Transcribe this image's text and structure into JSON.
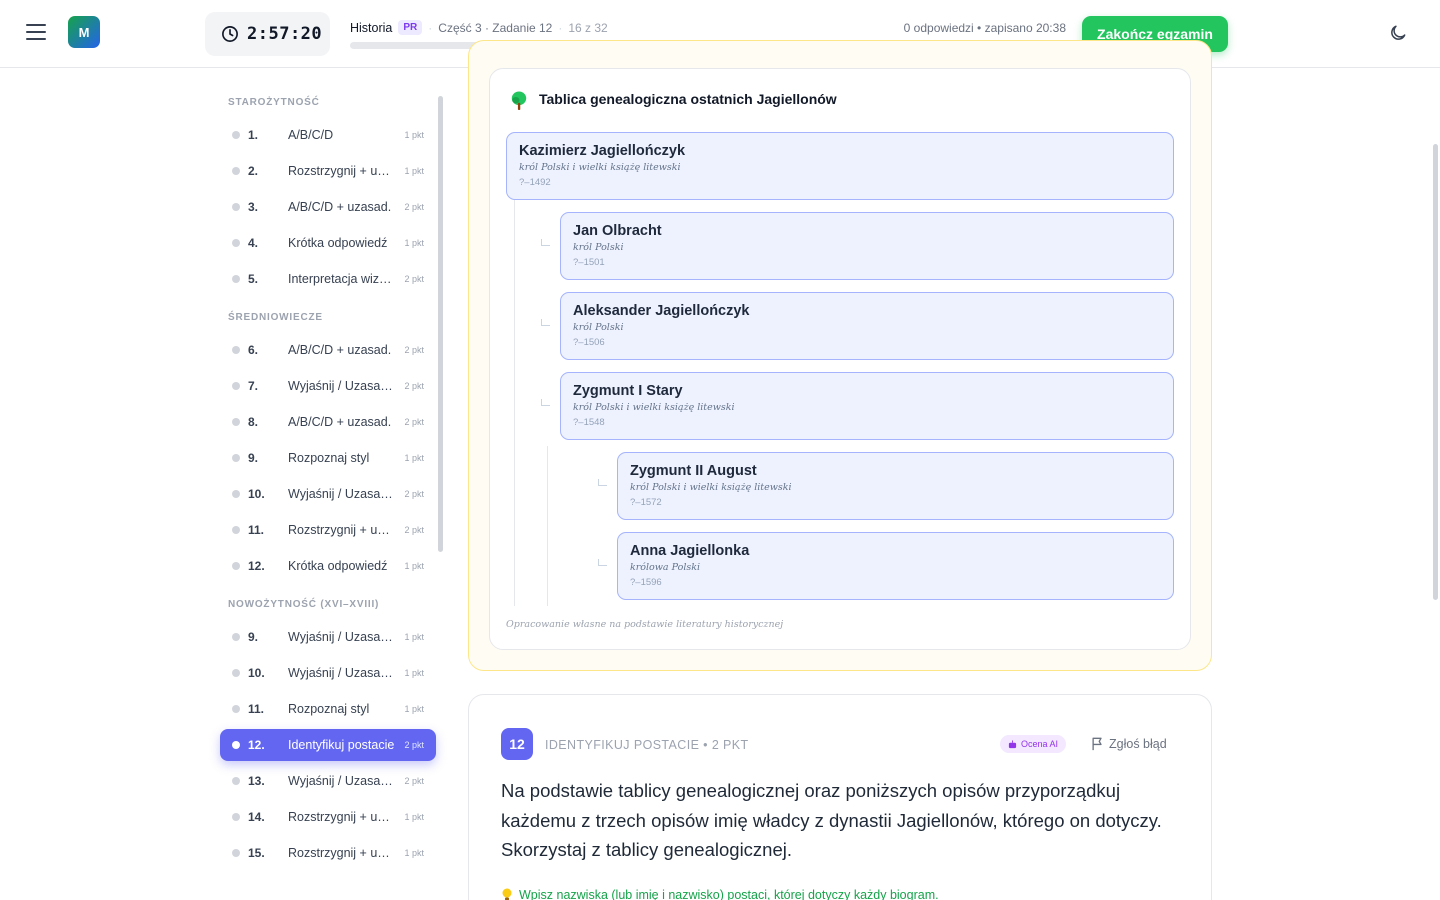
{
  "header": {
    "logo_letter": "M",
    "timer": "2:57:20",
    "subject": "Historia",
    "level_badge": "PR",
    "part_task": "Część 3 · Zadanie 12",
    "position": "16 z 32",
    "saved_status": "0 odpowiedzi • zapisano 20:38",
    "progress_fraction": 0.0,
    "finish_label": "Zakończ egzamin"
  },
  "sidebar": {
    "sections": [
      {
        "title": "STAROŻYTNOŚĆ",
        "items": [
          {
            "num": "1.",
            "label": "A/B/C/D",
            "pts": "1 pkt"
          },
          {
            "num": "2.",
            "label": "Rozstrzygnij + uzasad.",
            "pts": "1 pkt"
          },
          {
            "num": "3.",
            "label": "A/B/C/D + uzasad.",
            "pts": "2 pkt"
          },
          {
            "num": "4.",
            "label": "Krótka odpowiedź",
            "pts": "1 pkt"
          },
          {
            "num": "5.",
            "label": "Interpretacja wizualna",
            "pts": "2 pkt"
          }
        ]
      },
      {
        "title": "ŚREDNIOWIECZE",
        "items": [
          {
            "num": "6.",
            "label": "A/B/C/D + uzasad.",
            "pts": "2 pkt"
          },
          {
            "num": "7.",
            "label": "Wyjaśnij / Uzasadnij",
            "pts": "2 pkt"
          },
          {
            "num": "8.",
            "label": "A/B/C/D + uzasad.",
            "pts": "2 pkt"
          },
          {
            "num": "9.",
            "label": "Rozpoznaj styl",
            "pts": "1 pkt"
          },
          {
            "num": "10.",
            "label": "Wyjaśnij / Uzasadnij",
            "pts": "2 pkt"
          },
          {
            "num": "11.",
            "label": "Rozstrzygnij + uzasad.",
            "pts": "2 pkt"
          },
          {
            "num": "12.",
            "label": "Krótka odpowiedź",
            "pts": "1 pkt"
          }
        ]
      },
      {
        "title": "NOWOŻYTNOŚĆ (XVI–XVIII)",
        "items": [
          {
            "num": "9.",
            "label": "Wyjaśnij / Uzasadnij",
            "pts": "1 pkt"
          },
          {
            "num": "10.",
            "label": "Wyjaśnij / Uzasadnij",
            "pts": "1 pkt"
          },
          {
            "num": "11.",
            "label": "Rozpoznaj styl",
            "pts": "1 pkt"
          },
          {
            "num": "12.",
            "label": "Identyfikuj postacie",
            "pts": "2 pkt",
            "active": true
          },
          {
            "num": "13.",
            "label": "Wyjaśnij / Uzasadnij",
            "pts": "2 pkt"
          },
          {
            "num": "14.",
            "label": "Rozstrzygnij + uzasad.",
            "pts": "1 pkt"
          },
          {
            "num": "15.",
            "label": "Rozstrzygnij + uzasad.",
            "pts": "1 pkt"
          }
        ]
      }
    ]
  },
  "source": {
    "icon": "tree-icon",
    "title": "Tablica genealogiczna ostatnich Jagiellonów",
    "persons": [
      {
        "name": "Kazimierz Jagiellończyk",
        "role": "król Polski i wielki książę litewski",
        "dates": "?–1492"
      },
      {
        "name": "Jan Olbracht",
        "role": "król Polski",
        "dates": "?–1501"
      },
      {
        "name": "Aleksander Jagiellończyk",
        "role": "król Polski",
        "dates": "?–1506"
      },
      {
        "name": "Zygmunt I Stary",
        "role": "król Polski i wielki książę litewski",
        "dates": "?–1548"
      },
      {
        "name": "Zygmunt II August",
        "role": "król Polski i wielki książę litewski",
        "dates": "?–1572"
      },
      {
        "name": "Anna Jagiellonka",
        "role": "królowa Polski",
        "dates": "?–1596"
      }
    ],
    "note": "Opracowanie własne na podstawie literatury historycznej"
  },
  "question": {
    "number": "12",
    "type": "IDENTYFIKUJ POSTACIE • 2 PKT",
    "ai_badge": "Ocena AI",
    "report_label": "Zgłoś błąd",
    "text": "Na podstawie tablicy genealogicznej oraz poniższych opisów przyporządkuj każdemu z trzech opisów imię władcy z dynastii Jagiellonów, którego on dotyczy. Skorzystaj z tablicy genealogicznej.",
    "hint": "Wpisz nazwiska (lub imię i nazwisko) postaci, której dotyczy każdy biogram."
  },
  "colors": {
    "accent": "#6366f1",
    "finish": "#22c55e",
    "source_border": "#fde68a",
    "person_bg": "#eef2ff",
    "person_border": "#a5b4fc",
    "hint": "#16a34a"
  }
}
